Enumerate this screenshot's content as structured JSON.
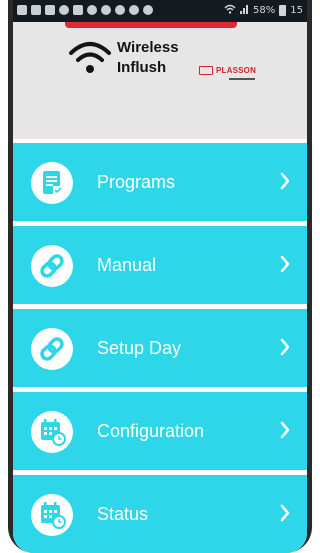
{
  "status_bar": {
    "signal_text": "58%",
    "time_partial": "15"
  },
  "header": {
    "app_name_line1": "Wireless",
    "app_name_line2": "Inflush",
    "partner_brand": "PLASSON"
  },
  "colors": {
    "menu_bg": "#2dd6e8",
    "header_bg": "#e6e6e6",
    "accent_red": "#e02a32",
    "text_on_menu": "#ffffff"
  },
  "menu": {
    "items": [
      {
        "label": "Programs",
        "icon": "programs-clipboard-icon"
      },
      {
        "label": "Manual",
        "icon": "link-icon"
      },
      {
        "label": "Setup Day",
        "icon": "link-icon"
      },
      {
        "label": "Configuration",
        "icon": "calendar-clock-icon"
      },
      {
        "label": "Status",
        "icon": "calendar-clock-icon"
      }
    ]
  }
}
